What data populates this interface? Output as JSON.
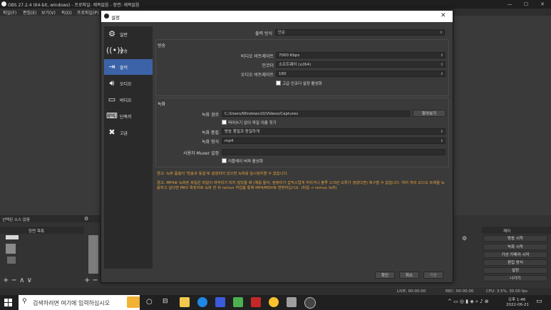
{
  "obs": {
    "title": "OBS 27.2.4 (64-bit, windows) - 프로파일: 제목없음 - 장면: 제목없음",
    "menu": [
      "파일(F)",
      "편집(E)",
      "보기(V)",
      "독(D)",
      "프로파일(P)"
    ],
    "sources_header": "선택된 소스 없음",
    "scene_list_header": "장면 목록",
    "controls_header": "제어",
    "controls": [
      "방송 시작",
      "녹화 시작",
      "가상 카메라 시작",
      "편집 방식",
      "설정",
      "나가기"
    ],
    "status": {
      "live": "LIVE: 00:00:00",
      "rec": "REC: 00:00:00",
      "cpu": "CPU: 3.5%, 30.00 fps"
    }
  },
  "dialog": {
    "title": "설정",
    "sidebar": [
      {
        "label": "일반",
        "icon": "gear-icon"
      },
      {
        "label": "방송",
        "icon": "broadcast-icon"
      },
      {
        "label": "출력",
        "icon": "output-icon"
      },
      {
        "label": "오디오",
        "icon": "speaker-icon"
      },
      {
        "label": "비디오",
        "icon": "monitor-icon"
      },
      {
        "label": "단축키",
        "icon": "keyboard-icon"
      },
      {
        "label": "고급",
        "icon": "tools-icon"
      }
    ],
    "output_mode_label": "출력 방식",
    "output_mode_value": "단순",
    "streaming": {
      "title": "방송",
      "video_bitrate_label": "비디오 비트레이트",
      "video_bitrate_value": "7000 Kbps",
      "encoder_label": "인코더",
      "encoder_value": "소프트웨어 (x264)",
      "audio_bitrate_label": "오디오 비트레이트",
      "audio_bitrate_value": "160",
      "advanced_label": "고급 인코더 설정 활성화"
    },
    "recording": {
      "title": "녹화",
      "path_label": "녹화 경로",
      "path_value": "C:/Users/Windows10/Videos/Captures",
      "browse_label": "찾아보기",
      "no_space_label": "띄어쓰기 없이 파일 이름 짓기",
      "quality_label": "녹화 품질",
      "quality_value": "방송 품질과 동일하게",
      "format_label": "녹화 형식",
      "format_value": "mp4",
      "muxer_label": "사용자 Muxer 설정",
      "replay_label": "리플레이 버퍼 활성화"
    },
    "warning1": "경고: 녹화 품질이 '방송과 동일'로 설정되어 있으면 녹화를 일시정지할 수 없습니다.",
    "warning2": "경고: MP4로 녹화된 파일은 파일이 마무리가 되지 않았을 때 (예를 들어, 컴퓨터가 갑작스럽게 꺼지거나 블루 스크린 오류가 생겼다면) 복구할 수 없습니다. 여러 개의 오디오 트랙을 녹음하고 싶다면 MKV 확장자로 녹화 한 뒤 remux 작업을 통해 MP4/MOV로 변환하십시오. (파일 → remux 녹화)",
    "buttons": {
      "ok": "확인",
      "cancel": "취소",
      "apply": "적용"
    }
  },
  "taskbar": {
    "search_placeholder": "검색하려면 여기에 입력하십시오",
    "time": "오후 1:46",
    "date": "2022-06-21"
  }
}
